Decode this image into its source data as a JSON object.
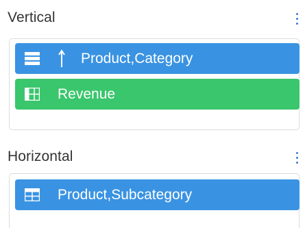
{
  "colors": {
    "blue_pill": "#3a93e2",
    "green_pill": "#3ac66c",
    "kebab": "#3a7bd5",
    "section_title": "#333333",
    "border": "#dcdcdc"
  },
  "vertical": {
    "title": "Vertical",
    "menu_icon": "kebab-vertical-icon",
    "items": [
      {
        "label": "Product,Category",
        "icon": "rows-icon",
        "sort_icon": "sort-ascending-arrow-icon"
      },
      {
        "label": "Revenue",
        "icon": "table-grid-icon"
      }
    ]
  },
  "horizontal": {
    "title": "Horizontal",
    "menu_icon": "kebab-vertical-icon",
    "items": [
      {
        "label": "Product,Subcategory",
        "icon": "table-grid-icon"
      }
    ]
  }
}
